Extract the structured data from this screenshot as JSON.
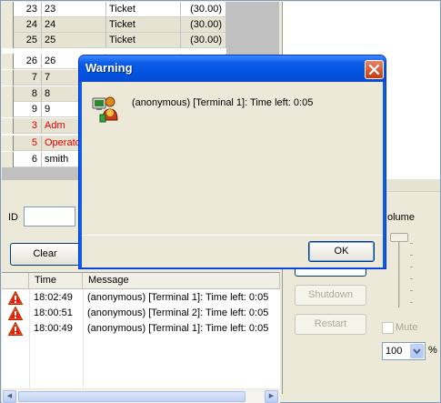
{
  "grid": {
    "rows": [
      {
        "num": "23",
        "name": "23",
        "type": "Ticket",
        "amount": "(30.00)",
        "red": false
      },
      {
        "num": "24",
        "name": "24",
        "type": "Ticket",
        "amount": "(30.00)",
        "red": false
      },
      {
        "num": "25",
        "name": "25",
        "type": "Ticket",
        "amount": "(30.00)",
        "red": false
      },
      {
        "num": "26",
        "name": "26",
        "type": "",
        "amount": "",
        "red": false
      },
      {
        "num": "7",
        "name": "7",
        "type": "",
        "amount": "",
        "red": false
      },
      {
        "num": "8",
        "name": "8",
        "type": "",
        "amount": "",
        "red": false
      },
      {
        "num": "9",
        "name": "9",
        "type": "",
        "amount": "",
        "red": false
      },
      {
        "num": "3",
        "name": "Adm",
        "type": "",
        "amount": "",
        "red": true
      },
      {
        "num": "5",
        "name": "Operato",
        "type": "",
        "amount": "",
        "red": true
      },
      {
        "num": "6",
        "name": "smith",
        "type": "",
        "amount": "",
        "red": false
      }
    ]
  },
  "filter": {
    "id_label": "ID",
    "id_value": "",
    "clear_label": "Clear"
  },
  "log": {
    "headers": {
      "time": "Time",
      "message": "Message"
    },
    "rows": [
      {
        "icon": "warning-icon",
        "time": "18:02:49",
        "message": "(anonymous) [Terminal 1]: Time left: 0:05"
      },
      {
        "icon": "warning-icon",
        "time": "18:00:51",
        "message": "(anonymous) [Terminal 2]: Time left: 0:05"
      },
      {
        "icon": "warning-icon",
        "time": "18:00:49",
        "message": "(anonymous) [Terminal 1]: Time left: 0:05"
      }
    ]
  },
  "controls": {
    "volume_label": "olume",
    "shutdown_label": "Shutdown",
    "restart_label": "Restart",
    "mute_label": "Mute",
    "volume_percent": "100",
    "percent_sign": "%"
  },
  "dialog": {
    "title": "Warning",
    "message": "(anonymous) [Terminal 1]: Time left: 0:05",
    "ok_label": "OK",
    "icon": "terminal-user-icon"
  },
  "colors": {
    "title_bar": "#0052df",
    "close_button": "#c33b12",
    "error_text": "#e00000"
  }
}
